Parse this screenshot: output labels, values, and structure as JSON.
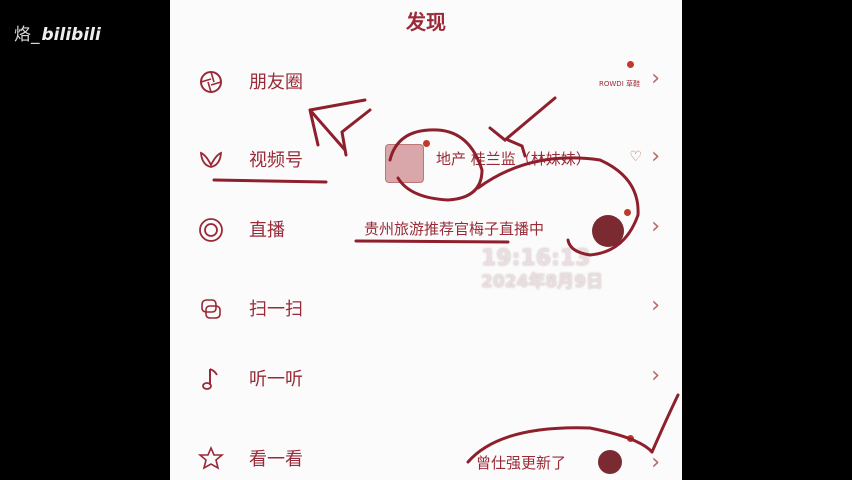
{
  "watermark": {
    "handle": "烙_",
    "brand": "bilibili"
  },
  "header": {
    "title": "发现"
  },
  "rows": [
    {
      "label": "朋友圈",
      "preview": "",
      "mini_text": "ROWDI 草鞋"
    },
    {
      "label": "视频号",
      "preview": "地产 桂兰监（林妹妹）"
    },
    {
      "label": "直播",
      "preview": "贵州旅游推荐官梅子直播中"
    },
    {
      "label": "扫一扫",
      "preview": ""
    },
    {
      "label": "听一听",
      "preview": ""
    },
    {
      "label": "看一看",
      "preview": "曾仕强更新了"
    }
  ],
  "overlay": {
    "time": "19:16:13",
    "date": "2024年8月9日"
  },
  "colors": {
    "accent": "#9a2a38",
    "annotation": "#8e1f2c",
    "badge": "#c0392b"
  },
  "icons": [
    "moments-icon",
    "channels-icon",
    "live-icon",
    "scan-icon",
    "listen-icon",
    "look-icon"
  ]
}
